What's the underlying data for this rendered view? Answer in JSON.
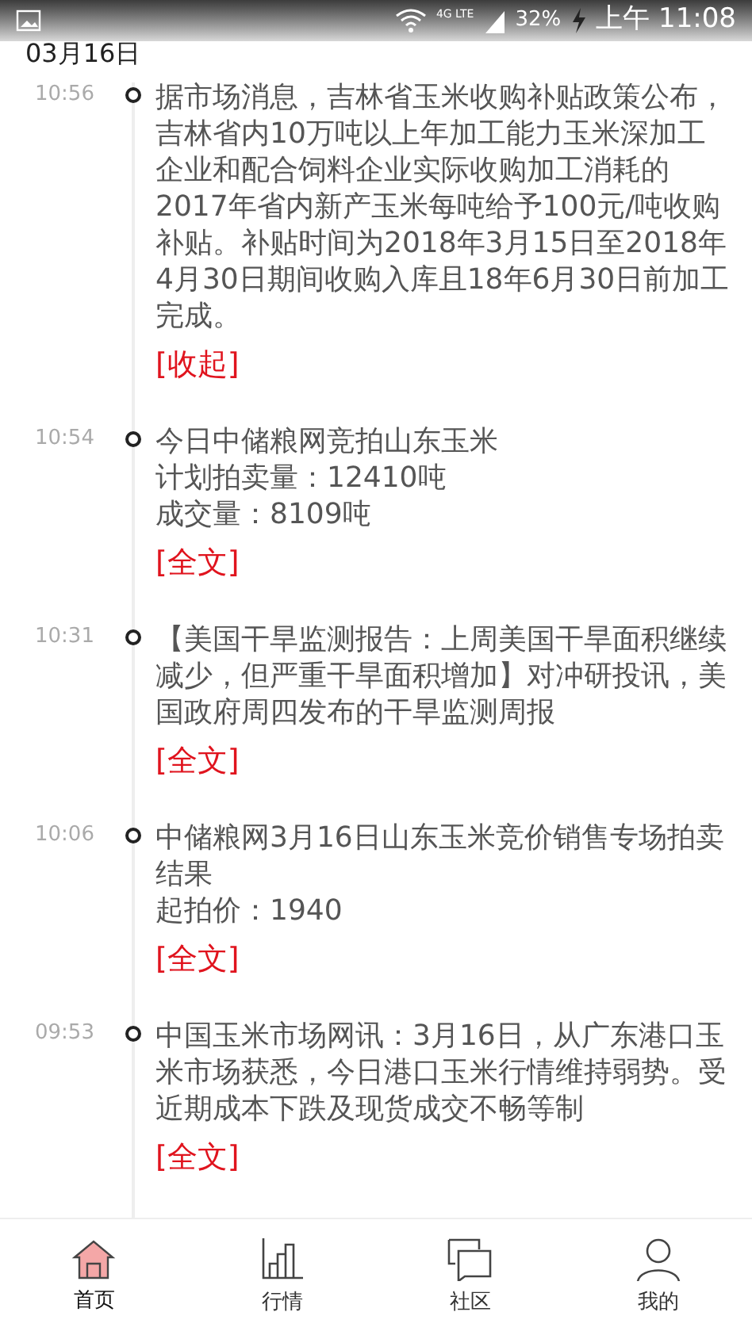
{
  "status_bar": {
    "network": "4G LTE",
    "battery": "32%",
    "time": "上午 11:08"
  },
  "date": "03月16日",
  "news": [
    {
      "time": "10:56",
      "lines": [
        "据市场消息，吉林省玉米收购补贴政策公布，吉林省内10万吨以上年加工能力玉米深加工企业和配合饲料企业实际收购加工消耗的2017年省内新产玉米每吨给予100元/吨收购补贴。补贴时间为2018年3月15日至2018年4月30日期间收购入库且18年6月30日前加工完成。"
      ],
      "link": "[收起]"
    },
    {
      "time": "10:54",
      "lines": [
        "今日中储粮网竞拍山东玉米",
        "计划拍卖量：12410吨",
        "成交量：8109吨"
      ],
      "link": "[全文]"
    },
    {
      "time": "10:31",
      "lines": [
        "【美国干旱监测报告：上周美国干旱面积继续减少，但严重干旱面积增加】对冲研投讯，美国政府周四发布的干旱监测周报"
      ],
      "link": "[全文]"
    },
    {
      "time": "10:06",
      "lines": [
        "中储粮网3月16日山东玉米竞价销售专场拍卖结果",
        "起拍价：1940"
      ],
      "link": "[全文]"
    },
    {
      "time": "09:53",
      "lines": [
        "中国玉米市场网讯：3月16日，从广东港口玉米市场获悉，今日港口玉米行情维持弱势。受近期成本下跌及现货成交不畅等制"
      ],
      "link": "[全文]"
    }
  ],
  "nav": [
    {
      "kind": "home",
      "label": "首页",
      "selected": true
    },
    {
      "kind": "market",
      "label": "行情",
      "selected": false
    },
    {
      "kind": "community",
      "label": "社区",
      "selected": false
    },
    {
      "kind": "profile",
      "label": "我的",
      "selected": false
    }
  ]
}
